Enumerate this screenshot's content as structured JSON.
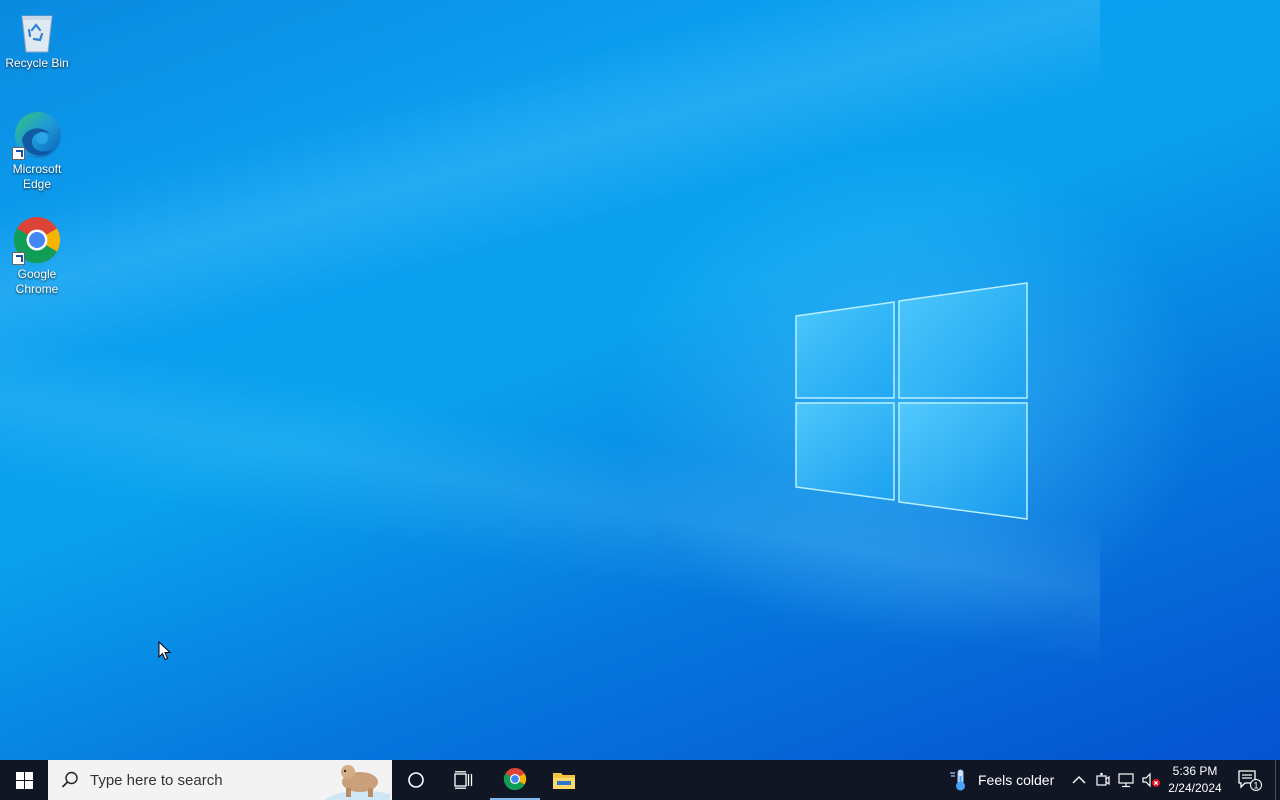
{
  "desktop": {
    "icons": [
      {
        "label": "Recycle Bin",
        "icon": "recycle-bin-icon"
      },
      {
        "label": "Microsoft Edge",
        "icon": "edge-icon"
      },
      {
        "label": "Google Chrome",
        "icon": "chrome-icon"
      }
    ]
  },
  "taskbar": {
    "search_placeholder": "Type here to search",
    "pinned": [
      "chrome-icon",
      "file-explorer-icon"
    ],
    "weather_text": "Feels colder",
    "clock_time": "5:36 PM",
    "clock_date": "2/24/2024",
    "notification_count": "1"
  },
  "colors": {
    "wallpaper_blue": "#0a9ff0",
    "taskbar_bg": "#101623",
    "search_bg": "#f3f3f3"
  }
}
